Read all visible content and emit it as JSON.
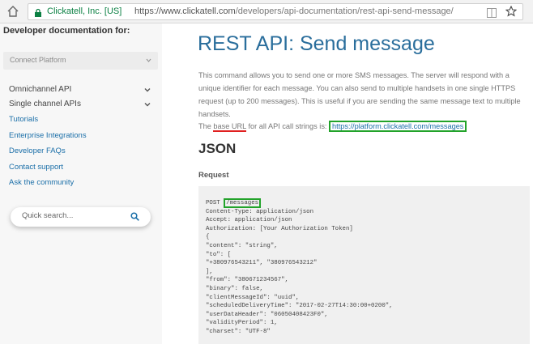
{
  "browser": {
    "site_identity": "Clickatell, Inc. [US]",
    "url_base": "https://www.clickatell.com",
    "url_path": "/developers/api-documentation/rest-api-send-message/"
  },
  "sidebar": {
    "title": "Developer documentation for:",
    "platform_select": "Connect Platform",
    "expandable": [
      {
        "label": "Omnichannel API"
      },
      {
        "label": "Single channel APIs"
      }
    ],
    "links": [
      {
        "label": "Tutorials"
      },
      {
        "label": "Enterprise Integrations"
      },
      {
        "label": "Developer FAQs"
      },
      {
        "label": "Contact support"
      },
      {
        "label": "Ask the community"
      }
    ],
    "search_placeholder": "Quick search..."
  },
  "main": {
    "title": "REST API: Send message",
    "description": "This command allows you to send one or more SMS messages. The server will respond with a unique identifier for each message. You can also send to multiple handsets in one single HTTPS request (up to 200 messages). This is useful if you are sending the same message text to multiple handsets.",
    "base_url_prefix": "The ",
    "base_url_term": "base URL",
    "base_url_middle": " for all API call strings is: ",
    "base_url_link": "https://platform.clickatell.com/messages",
    "json_heading": "JSON",
    "request_label": "Request",
    "code_method": "POST ",
    "code_endpoint": "/messages",
    "code_lines": [
      "Content-Type: application/json",
      "Accept: application/json",
      "Authorization: [Your Authorization Token]",
      "{",
      "\"content\": \"string\",",
      "\"to\": [",
      "\"+380976543211\", \"380976543212\"",
      "],",
      "\"from\": \"380671234567\",",
      "\"binary\": false,",
      "\"clientMessageId\": \"uuid\",",
      "\"scheduledDeliveryTime\": \"2017-02-27T14:30:00+0200\",",
      "\"userDataHeader\": \"06050408423F0\",",
      "\"validityPeriod\": 1,",
      "\"charset\": \"UTF-8\""
    ]
  }
}
